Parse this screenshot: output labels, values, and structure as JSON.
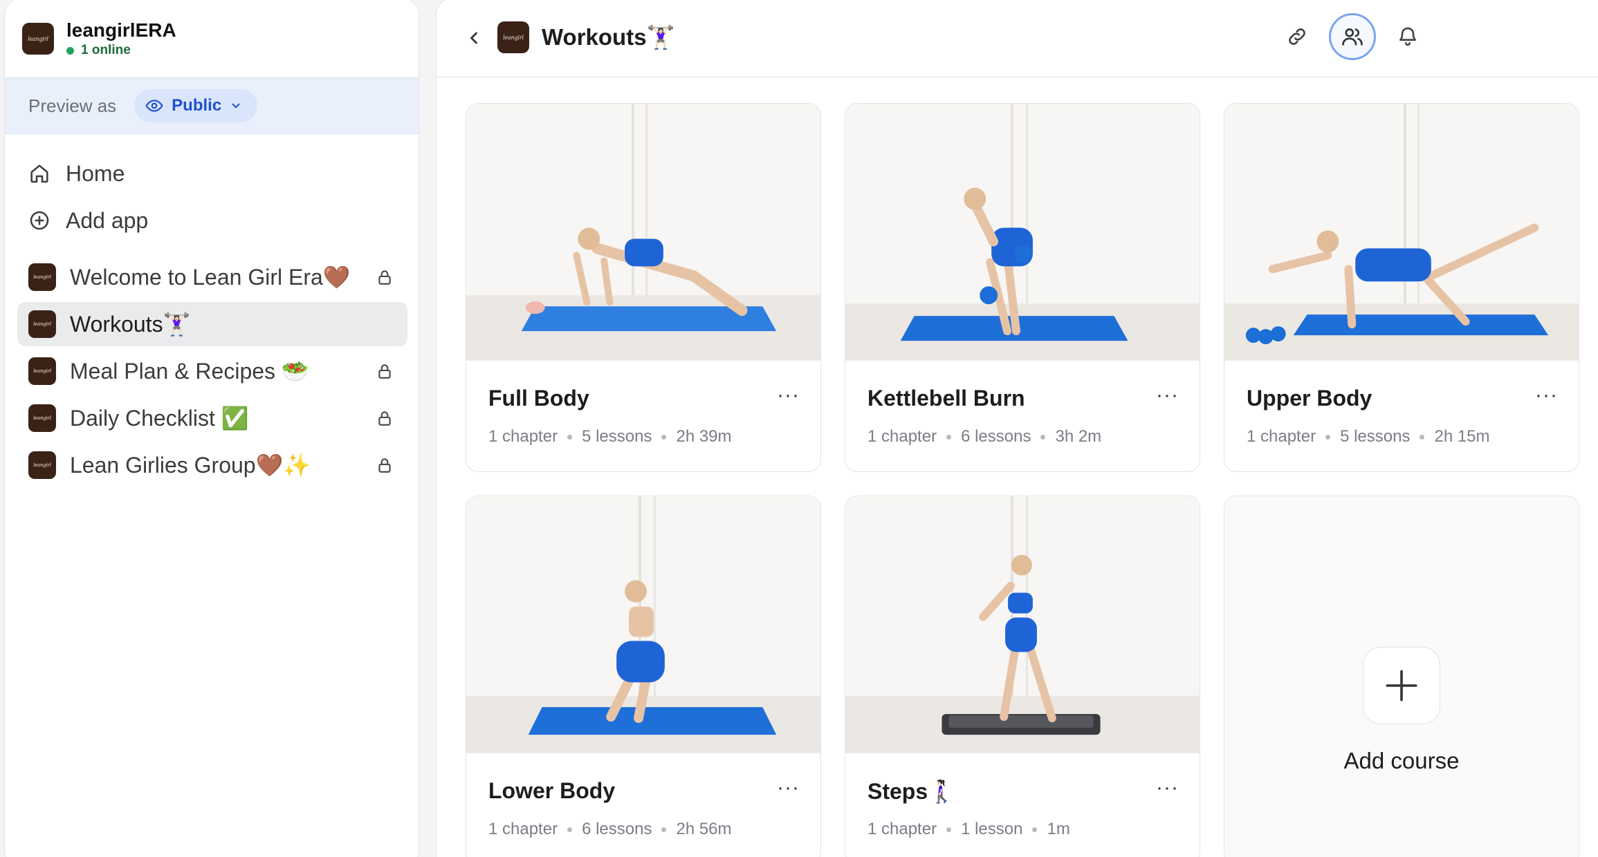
{
  "workspace": {
    "name": "leangirlERA",
    "online": "1 online",
    "logo_text": "leangirl"
  },
  "preview": {
    "label": "Preview as",
    "value": "Public"
  },
  "nav": [
    {
      "label": "Home",
      "icon": "home-icon"
    },
    {
      "label": "Add app",
      "icon": "plus-circle-icon"
    }
  ],
  "apps": [
    {
      "label": "Welcome to Lean Girl Era🤎",
      "locked": true,
      "active": false
    },
    {
      "label": "Workouts🏋🏻‍♀️",
      "locked": false,
      "active": true
    },
    {
      "label": "Meal Plan & Recipes 🥗",
      "locked": true,
      "active": false
    },
    {
      "label": "Daily Checklist ✅",
      "locked": true,
      "active": false
    },
    {
      "label": "Lean Girlies Group🤎✨",
      "locked": true,
      "active": false
    }
  ],
  "header": {
    "title": "Workouts🏋🏻‍♀️"
  },
  "courses": [
    {
      "title": "Full Body",
      "chapters": "1 chapter",
      "lessons": "5 lessons",
      "duration": "2h 39m",
      "more": "···"
    },
    {
      "title": "Kettlebell Burn",
      "chapters": "1 chapter",
      "lessons": "6 lessons",
      "duration": "3h 2m",
      "more": "···"
    },
    {
      "title": "Upper Body",
      "chapters": "1 chapter",
      "lessons": "5 lessons",
      "duration": "2h 15m",
      "more": "···"
    },
    {
      "title": "Lower Body",
      "chapters": "1 chapter",
      "lessons": "6 lessons",
      "duration": "2h 56m",
      "more": "···"
    },
    {
      "title": "Steps🚶🏻‍♀️",
      "chapters": "1 chapter",
      "lessons": "1 lesson",
      "duration": "1m",
      "more": "···"
    }
  ],
  "add_course": {
    "label": "Add course"
  },
  "colors": {
    "accent": "#1f4fd1",
    "mat_blue": "#1f6fd9",
    "logo_brown": "#3a2216",
    "online_green": "#1fa55a"
  }
}
